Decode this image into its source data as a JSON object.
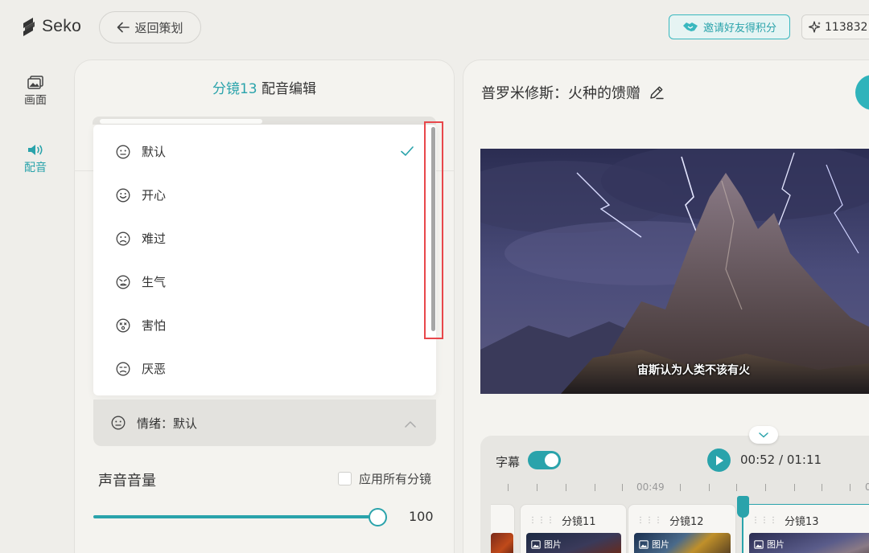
{
  "app": {
    "name": "Seko"
  },
  "header": {
    "back_label": "返回策划",
    "invite_label": "邀请好友得积分",
    "points": "113832"
  },
  "nav": {
    "items": [
      {
        "label": "画面",
        "icon": "image-icon",
        "active": false
      },
      {
        "label": "配音",
        "icon": "speaker-icon",
        "active": true
      }
    ]
  },
  "editor": {
    "shot": "分镜13",
    "title": "配音编辑",
    "emotion_options": [
      {
        "label": "默认",
        "icon": "neutral-face-icon",
        "selected": true
      },
      {
        "label": "开心",
        "icon": "happy-face-icon",
        "selected": false
      },
      {
        "label": "难过",
        "icon": "sad-face-icon",
        "selected": false
      },
      {
        "label": "生气",
        "icon": "angry-face-icon",
        "selected": false
      },
      {
        "label": "害怕",
        "icon": "scared-face-icon",
        "selected": false
      },
      {
        "label": "厌恶",
        "icon": "disgust-face-icon",
        "selected": false
      }
    ],
    "emotion_field": "情绪：默认",
    "volume_label": "声音音量",
    "apply_all_label": "应用所有分镜",
    "volume_value": "100",
    "volume_fraction": 1.0
  },
  "preview": {
    "project_title": "普罗米修斯：火种的馈赠",
    "subtitle": "宙斯认为人类不该有火"
  },
  "timeline": {
    "subtitle_toggle_label": "字幕",
    "subtitle_on": true,
    "time": "00:52 / 01:11",
    "tick_label": "00:49",
    "tick_label_cut": "0",
    "clips": [
      {
        "name": "分镜11",
        "badge": "图片"
      },
      {
        "name": "分镜12",
        "badge": "图片"
      },
      {
        "name": "分镜13",
        "badge": "图片"
      }
    ]
  },
  "colors": {
    "accent": "#2aa3ab",
    "highlight": "#e8474b",
    "background": "#efeeea"
  }
}
